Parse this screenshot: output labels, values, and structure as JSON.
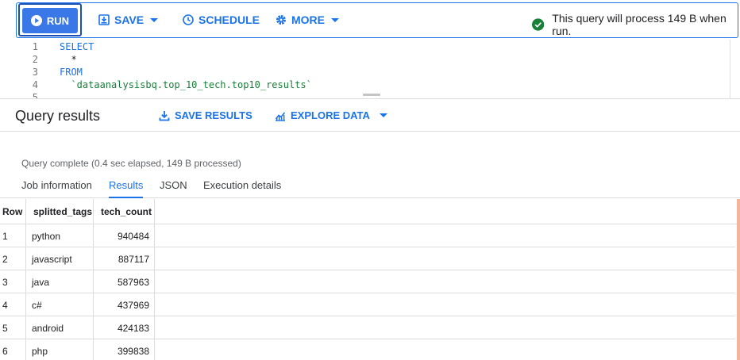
{
  "toolbar": {
    "run_label": "RUN",
    "save_label": "SAVE",
    "schedule_label": "SCHEDULE",
    "more_label": "MORE",
    "status_text": "This query will process 149 B when run.",
    "accent_color": "#1a73e8",
    "status_color": "#188038"
  },
  "editor": {
    "lines": [
      {
        "n": "1",
        "text": "SELECT"
      },
      {
        "n": "2",
        "text": "  *"
      },
      {
        "n": "3",
        "text": "FROM"
      },
      {
        "n": "4",
        "text": "  `dataanalysisbq.top_10_tech.top10_results`"
      },
      {
        "n": "5",
        "text": ""
      }
    ]
  },
  "results": {
    "title": "Query results",
    "save_results_label": "SAVE RESULTS",
    "explore_data_label": "EXPLORE DATA",
    "complete_text": "Query complete (0.4 sec elapsed, 149 B processed)"
  },
  "tabs": [
    {
      "label": "Job information",
      "active": false
    },
    {
      "label": "Results",
      "active": true
    },
    {
      "label": "JSON",
      "active": false
    },
    {
      "label": "Execution details",
      "active": false
    }
  ],
  "table": {
    "columns": [
      "Row",
      "splitted_tags",
      "tech_count"
    ],
    "rows": [
      [
        "1",
        "python",
        "940484"
      ],
      [
        "2",
        "javascript",
        "887117"
      ],
      [
        "3",
        "java",
        "587963"
      ],
      [
        "4",
        "c#",
        "437969"
      ],
      [
        "5",
        "android",
        "424183"
      ],
      [
        "6",
        "php",
        "399838"
      ]
    ]
  }
}
